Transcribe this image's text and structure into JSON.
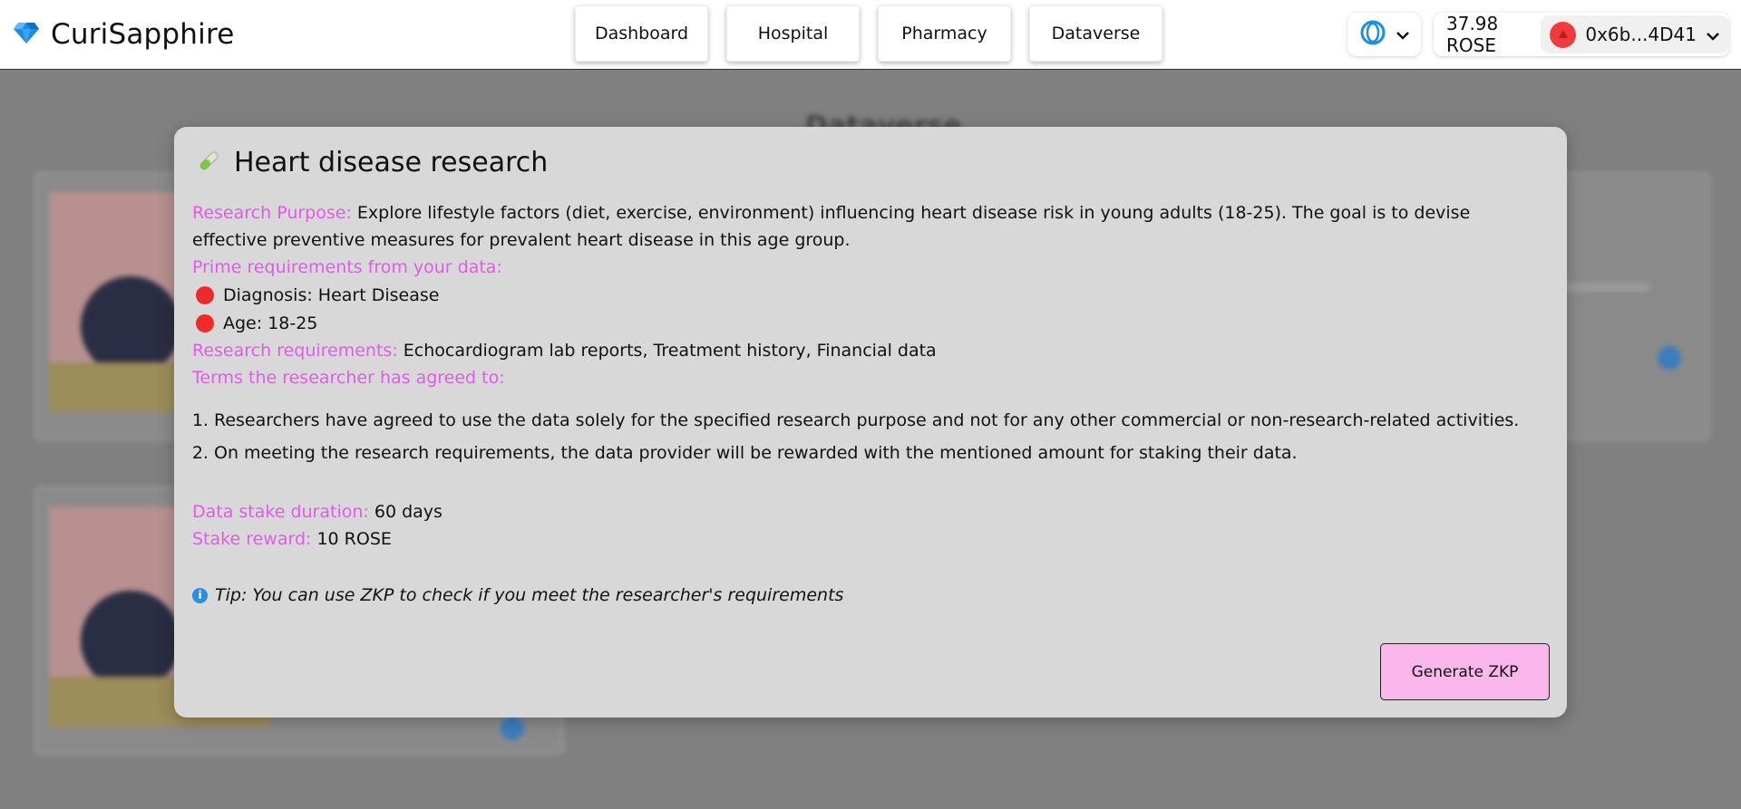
{
  "app": {
    "name": "CuriSapphire"
  },
  "nav": {
    "items": [
      "Dashboard",
      "Hospital",
      "Pharmacy",
      "Dataverse"
    ]
  },
  "wallet": {
    "balance": "37.98 ROSE",
    "account": "0x6b...4D41",
    "network_icon": "oasis-network-icon"
  },
  "background": {
    "page_title": "Dataverse"
  },
  "modal": {
    "title": "Heart disease research",
    "icon": "test-tube-icon",
    "purpose_label": "Research Purpose:",
    "purpose_text": "Explore lifestyle factors (diet, exercise, environment) influencing heart disease risk in young adults (18-25). The goal is to devise effective preventive measures for prevalent heart disease in this age group.",
    "prime_label": "Prime requirements from your data:",
    "prime_items": [
      "Diagnosis: Heart Disease",
      "Age: 18-25"
    ],
    "research_req_label": "Research requirements:",
    "research_req_text": "Echocardiogram lab reports, Treatment history, Financial data",
    "terms_label": "Terms the researcher has agreed to:",
    "terms": [
      "Researchers have agreed to use the data solely for the specified research purpose and not for any other commercial or non-research-related activities.",
      "On meeting the research requirements, the data provider will be rewarded with the mentioned amount for staking their data."
    ],
    "duration_label": "Data stake duration:",
    "duration_value": "60 days",
    "reward_label": "Stake reward:",
    "reward_value": "10 ROSE",
    "tip": "Tip: You can use ZKP to check if you meet the researcher's requirements",
    "generate_button": "Generate ZKP"
  },
  "colors": {
    "accent_label": "#e05ce8",
    "button_bg": "#fbb7ec",
    "info": "#2d8fdc",
    "status_dot": "#ee2b2b"
  }
}
